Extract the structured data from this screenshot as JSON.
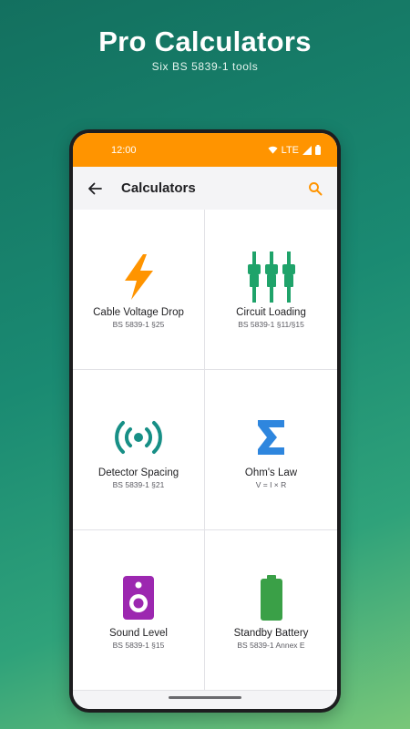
{
  "promo": {
    "title": "Pro Calculators",
    "subtitle": "Six BS 5839-1 tools"
  },
  "status_bar": {
    "time": "12:00",
    "network": "LTE",
    "color": "#ff9400"
  },
  "app_bar": {
    "title": "Calculators",
    "back_icon": "arrow-back-icon",
    "search_icon": "search-icon"
  },
  "calculators": [
    {
      "title": "Cable Voltage Drop",
      "ref": "BS 5839-1 §25",
      "icon": "lightning-bolt-icon",
      "color": "#ff9400"
    },
    {
      "title": "Circuit Loading",
      "ref": "BS 5839-1 §11/§15",
      "icon": "circuit-fuses-icon",
      "color": "#1fa36a"
    },
    {
      "title": "Detector Spacing",
      "ref": "BS 5839-1 §21",
      "icon": "broadcast-signal-icon",
      "color": "#178f86"
    },
    {
      "title": "Ohm's Law",
      "ref": "V = I × R",
      "icon": "sigma-icon",
      "color": "#2e86de"
    },
    {
      "title": "Sound Level",
      "ref": "BS 5839-1 §15",
      "icon": "speaker-icon",
      "color": "#9c27b0"
    },
    {
      "title": "Standby Battery",
      "ref": "BS 5839-1 Annex E",
      "icon": "battery-icon",
      "color": "#3aa047"
    }
  ]
}
